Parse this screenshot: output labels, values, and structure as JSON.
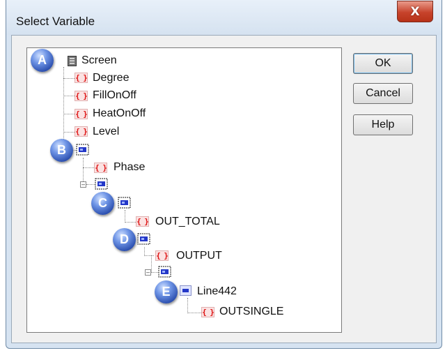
{
  "window": {
    "title": "Select Variable",
    "close_label": "X"
  },
  "buttons": {
    "ok": "OK",
    "cancel": "Cancel",
    "help": "Help"
  },
  "tree": {
    "root": "Screen",
    "badges": [
      "A",
      "B",
      "C",
      "D",
      "E"
    ],
    "screen_vars": [
      "Degree",
      "FillOnOff",
      "HeatOnOff",
      "Level"
    ],
    "group1_var": "Phase",
    "group3_var": "OUT_TOTAL",
    "group4_var": "OUTPUT",
    "line_object": "Line442",
    "line_var": "OUTSINGLE"
  }
}
